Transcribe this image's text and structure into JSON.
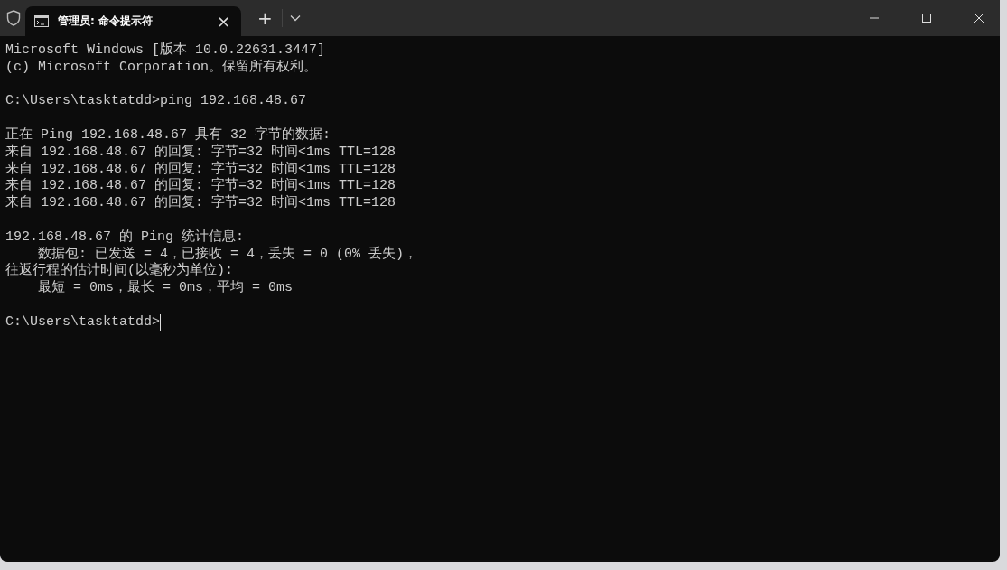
{
  "window": {
    "tabs": [
      {
        "title": "管理员: 命令提示符",
        "close": "×",
        "selected": true
      }
    ],
    "new_tab": "+"
  },
  "terminal": {
    "blocks": [
      [
        "Microsoft Windows [版本 10.0.22631.3447]",
        "(c) Microsoft Corporation。保留所有权利。"
      ],
      [
        "C:\\Users\\tasktatdd>ping 192.168.48.67"
      ],
      [
        "正在 Ping 192.168.48.67 具有 32 字节的数据:",
        "来自 192.168.48.67 的回复: 字节=32 时间<1ms TTL=128",
        "来自 192.168.48.67 的回复: 字节=32 时间<1ms TTL=128",
        "来自 192.168.48.67 的回复: 字节=32 时间<1ms TTL=128",
        "来自 192.168.48.67 的回复: 字节=32 时间<1ms TTL=128"
      ],
      [
        "192.168.48.67 的 Ping 统计信息:",
        "    数据包: 已发送 = 4，已接收 = 4，丢失 = 0 (0% 丢失)，",
        "往返行程的估计时间(以毫秒为单位):",
        "    最短 = 0ms，最长 = 0ms，平均 = 0ms"
      ]
    ],
    "prompt": "C:\\Users\\tasktatdd>",
    "cursor": true
  }
}
